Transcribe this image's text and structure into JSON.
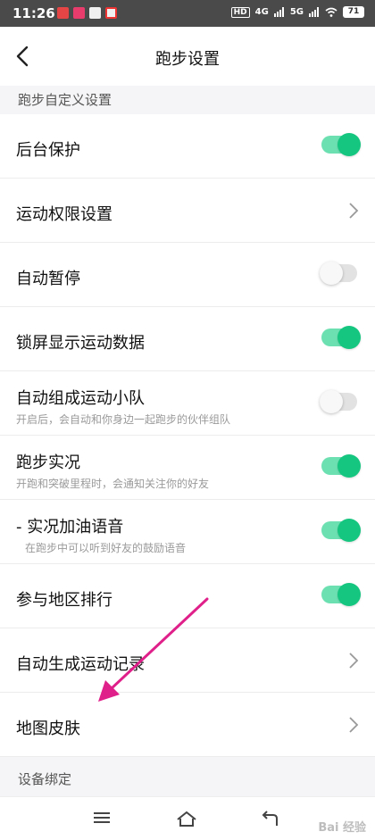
{
  "status_bar": {
    "time": "11:26",
    "hd": "HD",
    "net1": "4G",
    "net2": "5G",
    "battery": "71"
  },
  "header": {
    "title": "跑步设置",
    "back_icon": "chevron-left-icon"
  },
  "section1": {
    "title": "跑步自定义设置"
  },
  "rows": [
    {
      "label": "后台保护",
      "sub": "",
      "control": "toggle",
      "on": true
    },
    {
      "label": "运动权限设置",
      "sub": "",
      "control": "chevron"
    },
    {
      "label": "自动暂停",
      "sub": "",
      "control": "toggle",
      "on": false
    },
    {
      "label": "锁屏显示运动数据",
      "sub": "",
      "control": "toggle",
      "on": true
    },
    {
      "label": "自动组成运动小队",
      "sub": "开启后，会自动和你身边一起跑步的伙伴组队",
      "control": "toggle",
      "on": false
    },
    {
      "label": "跑步实况",
      "sub": "开跑和突破里程时，会通知关注你的好友",
      "control": "toggle",
      "on": true
    },
    {
      "label": "- 实况加油语音",
      "sub": "在跑步中可以听到好友的鼓励语音",
      "control": "toggle",
      "on": true
    },
    {
      "label": "参与地区排行",
      "sub": "",
      "control": "toggle",
      "on": true
    },
    {
      "label": "自动生成运动记录",
      "sub": "",
      "control": "chevron"
    },
    {
      "label": "地图皮肤",
      "sub": "",
      "control": "chevron"
    }
  ],
  "section2": {
    "title": "设备绑定"
  },
  "nav": {
    "icons": [
      "menu-icon",
      "home-icon",
      "back-icon"
    ]
  },
  "watermark": "Bai 经验",
  "colors": {
    "toggle_on_track": "#6de0b2",
    "toggle_on_knob": "#14c67f",
    "arrow": "#e0208a"
  }
}
